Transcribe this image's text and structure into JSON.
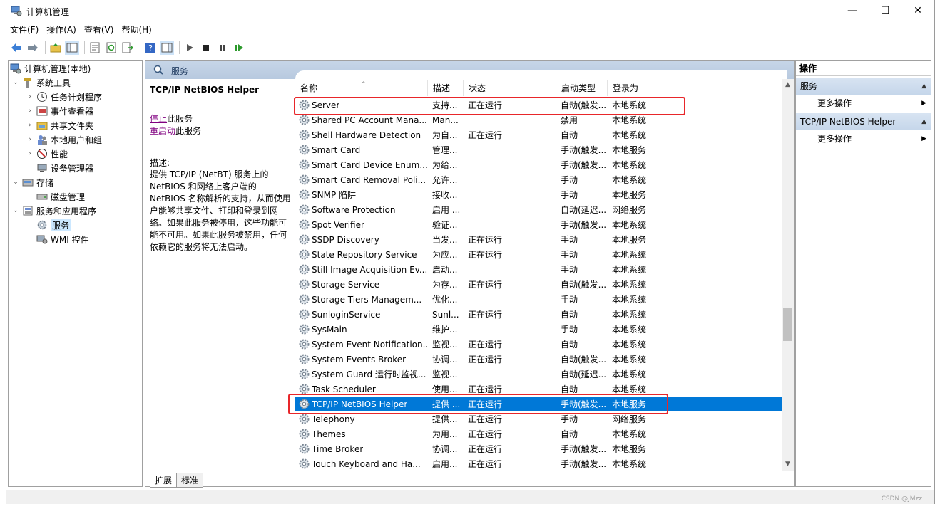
{
  "window": {
    "title": "计算机管理",
    "min": "—",
    "max": "☐",
    "close": "✕"
  },
  "menus": [
    "文件(F)",
    "操作(A)",
    "查看(V)",
    "帮助(H)"
  ],
  "tree": [
    {
      "label": "计算机管理(本地)",
      "icon": "computer-management-icon"
    },
    {
      "label": "系统工具",
      "icon": "tools-icon"
    },
    {
      "label": "任务计划程序",
      "icon": "clock-icon"
    },
    {
      "label": "事件查看器",
      "icon": "event-viewer-icon"
    },
    {
      "label": "共享文件夹",
      "icon": "shared-folder-icon"
    },
    {
      "label": "本地用户和组",
      "icon": "users-icon"
    },
    {
      "label": "性能",
      "icon": "performance-icon"
    },
    {
      "label": "设备管理器",
      "icon": "device-manager-icon"
    },
    {
      "label": "存储",
      "icon": "storage-icon"
    },
    {
      "label": "磁盘管理",
      "icon": "disk-icon"
    },
    {
      "label": "服务和应用程序",
      "icon": "services-apps-icon"
    },
    {
      "label": "服务",
      "icon": "services-icon"
    },
    {
      "label": "WMI 控件",
      "icon": "wmi-icon"
    }
  ],
  "center": {
    "header": "服务",
    "desc_title": "TCP/IP NetBIOS Helper",
    "stop_link": "停止",
    "stop_suffix": "此服务",
    "restart_link": "重启动",
    "restart_suffix": "此服务",
    "desc_label": "描述:",
    "desc_text": "提供 TCP/IP (NetBT) 服务上的 NetBIOS 和网络上客户端的 NetBIOS 名称解析的支持，从而使用户能够共享文件、打印和登录到网络。如果此服务被停用，这些功能可能不可用。如果此服务被禁用，任何依赖它的服务将无法启动。"
  },
  "columns": [
    "名称",
    "描述",
    "状态",
    "启动类型",
    "登录为"
  ],
  "services": [
    {
      "name": "Server",
      "desc": "支持...",
      "status": "正在运行",
      "start": "自动(触发...",
      "logon": "本地系统"
    },
    {
      "name": "Shared PC Account Mana...",
      "desc": "Man...",
      "status": "",
      "start": "禁用",
      "logon": "本地系统"
    },
    {
      "name": "Shell Hardware Detection",
      "desc": "为自...",
      "status": "正在运行",
      "start": "自动",
      "logon": "本地系统"
    },
    {
      "name": "Smart Card",
      "desc": "管理...",
      "status": "",
      "start": "手动(触发...",
      "logon": "本地服务"
    },
    {
      "name": "Smart Card Device Enum...",
      "desc": "为给...",
      "status": "",
      "start": "手动(触发...",
      "logon": "本地系统"
    },
    {
      "name": "Smart Card Removal Poli...",
      "desc": "允许...",
      "status": "",
      "start": "手动",
      "logon": "本地系统"
    },
    {
      "name": "SNMP 陷阱",
      "desc": "接收...",
      "status": "",
      "start": "手动",
      "logon": "本地服务"
    },
    {
      "name": "Software Protection",
      "desc": "启用 ...",
      "status": "",
      "start": "自动(延迟...",
      "logon": "网络服务"
    },
    {
      "name": "Spot Verifier",
      "desc": "验证...",
      "status": "",
      "start": "手动(触发...",
      "logon": "本地系统"
    },
    {
      "name": "SSDP Discovery",
      "desc": "当发...",
      "status": "正在运行",
      "start": "手动",
      "logon": "本地服务"
    },
    {
      "name": "State Repository Service",
      "desc": "为应...",
      "status": "正在运行",
      "start": "手动",
      "logon": "本地系统"
    },
    {
      "name": "Still Image Acquisition Ev...",
      "desc": "启动...",
      "status": "",
      "start": "手动",
      "logon": "本地系统"
    },
    {
      "name": "Storage Service",
      "desc": "为存...",
      "status": "正在运行",
      "start": "自动(触发...",
      "logon": "本地系统"
    },
    {
      "name": "Storage Tiers Managem...",
      "desc": "优化...",
      "status": "",
      "start": "手动",
      "logon": "本地系统"
    },
    {
      "name": "SunloginService",
      "desc": "Sunl...",
      "status": "正在运行",
      "start": "自动",
      "logon": "本地系统"
    },
    {
      "name": "SysMain",
      "desc": "维护...",
      "status": "",
      "start": "手动",
      "logon": "本地系统"
    },
    {
      "name": "System Event Notification...",
      "desc": "监视...",
      "status": "正在运行",
      "start": "自动",
      "logon": "本地系统"
    },
    {
      "name": "System Events Broker",
      "desc": "协调...",
      "status": "正在运行",
      "start": "自动(触发...",
      "logon": "本地系统"
    },
    {
      "name": "System Guard 运行时监视...",
      "desc": "监视...",
      "status": "",
      "start": "自动(延迟...",
      "logon": "本地系统"
    },
    {
      "name": "Task Scheduler",
      "desc": "使用...",
      "status": "正在运行",
      "start": "自动",
      "logon": "本地系统"
    },
    {
      "name": "TCP/IP NetBIOS Helper",
      "desc": "提供 ...",
      "status": "正在运行",
      "start": "手动(触发...",
      "logon": "本地服务"
    },
    {
      "name": "Telephony",
      "desc": "提供...",
      "status": "正在运行",
      "start": "手动",
      "logon": "网络服务"
    },
    {
      "name": "Themes",
      "desc": "为用...",
      "status": "正在运行",
      "start": "自动",
      "logon": "本地系统"
    },
    {
      "name": "Time Broker",
      "desc": "协调...",
      "status": "正在运行",
      "start": "手动(触发...",
      "logon": "本地服务"
    },
    {
      "name": "Touch Keyboard and Ha...",
      "desc": "启用...",
      "status": "正在运行",
      "start": "手动(触发...",
      "logon": "本地系统"
    }
  ],
  "selected_index": 20,
  "tabs": [
    "扩展",
    "标准"
  ],
  "actions": {
    "title": "操作",
    "sections": [
      {
        "label": "服务",
        "item": "更多操作"
      },
      {
        "label": "TCP/IP NetBIOS Helper",
        "item": "更多操作"
      }
    ]
  },
  "watermark": "CSDN @JMzz",
  "colors": {
    "selection": "#0078d7",
    "highlight_box": "#e8262a",
    "header": "#c7d6e8"
  }
}
